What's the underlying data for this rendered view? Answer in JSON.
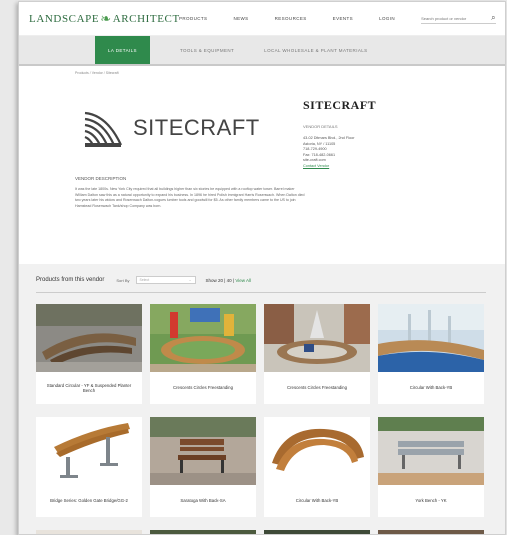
{
  "header": {
    "logo": {
      "left": "LANDSCAPE",
      "right": "ARCHITECT"
    },
    "nav": [
      "PRODUCTS",
      "NEWS",
      "RESOURCES",
      "EVENTS",
      "LOGIN"
    ],
    "search_placeholder": "Search product or vendor"
  },
  "subnav": {
    "tabs": [
      {
        "label": "LA DETAILS",
        "active": true
      },
      {
        "label": "TOOLS & EQUIPMENT",
        "active": false
      },
      {
        "label": "LOCAL WHOLESALE & PLANT MATERIALS",
        "active": false
      }
    ]
  },
  "breadcrumb": "Products / Vendor / Sitecraft",
  "vendor": {
    "brand_logo_text": "SITECRAFT",
    "name": "SITECRAFT",
    "details_heading": "VENDOR DETAILS",
    "address1": "43-02 Ditmars Blvd., 2nd Floor",
    "address2": "Astoria, NY / 11105",
    "phone": "718-729-4900",
    "fax": "Fax: 718-482-0661",
    "website": "site-craft.com",
    "contact": "Contact Vendor",
    "description_heading": "VENDOR DESCRIPTION",
    "description": "It was the late 1800s. New York City required that all buildings higher than six stories be equipped with a rooftop water tower. Barrel maker William Dalton saw this as a natural opportunity to expand his business. In 1896 he hired Polish immigrant Harris Rosenwach. When Dalton died two years later his widow and Rosenwach Dalton-vogues lumber tools and goodwill for $5. As other family members came to the US to join Hamstead Rosenwach Tank/shop Company was born."
  },
  "products": {
    "title": "Products from this vendor",
    "sort_label": "Sort By",
    "sort_value": "Select",
    "show_label": "Show 20 | 40 |",
    "view_all": "View All",
    "items": [
      {
        "name": "Standard Circular - YF & Suspended Planter Bench"
      },
      {
        "name": "Crescents Circles Freestanding"
      },
      {
        "name": "Crescents Circles Freestanding"
      },
      {
        "name": "Circular With Back-YB"
      },
      {
        "name": "Bridge Series: Golden Gate Bridge/GG-2"
      },
      {
        "name": "Saratoga With Back-SA"
      },
      {
        "name": "Circular With Back-YB"
      },
      {
        "name": "York Bench - YK"
      }
    ]
  },
  "colors": {
    "accent": "#2f8a4c",
    "logo": "#2d6b3f"
  }
}
